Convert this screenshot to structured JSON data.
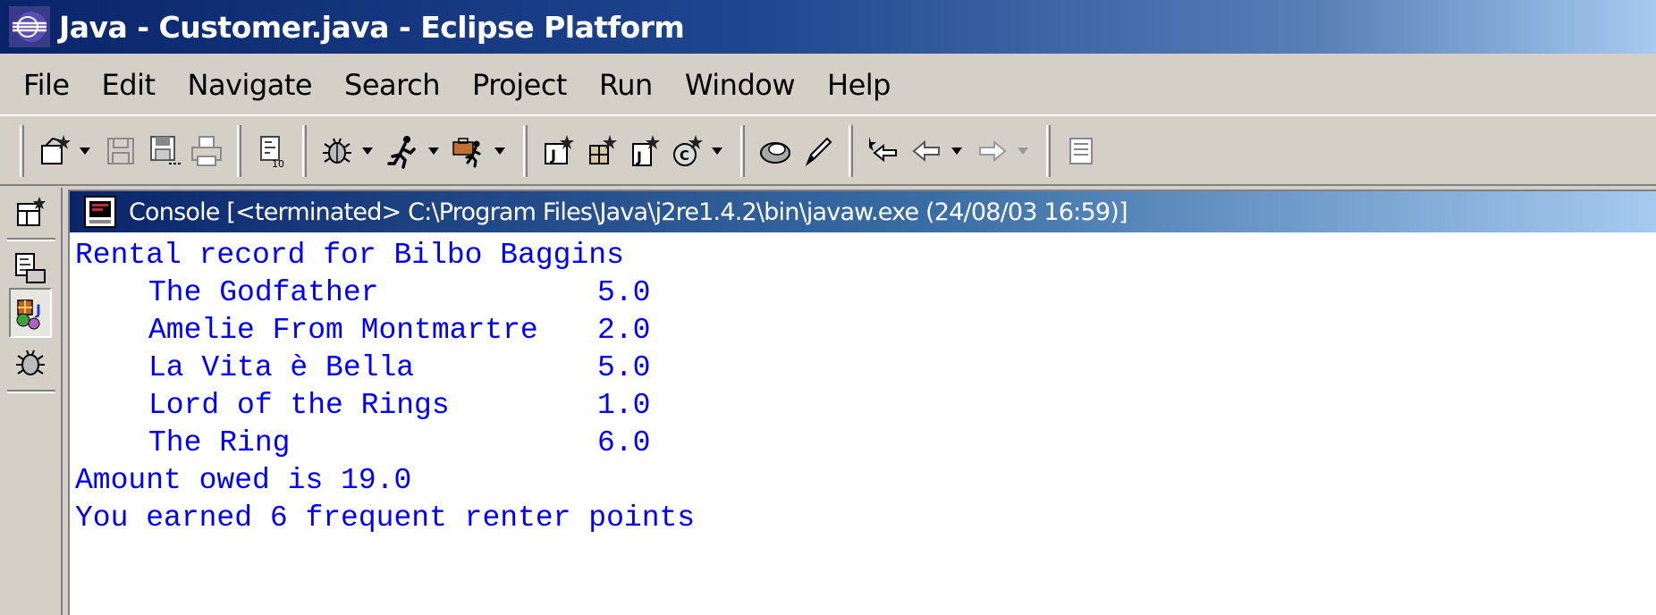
{
  "window": {
    "title": "Java - Customer.java - Eclipse Platform"
  },
  "menu": [
    "File",
    "Edit",
    "Navigate",
    "Search",
    "Project",
    "Run",
    "Window",
    "Help"
  ],
  "toolbar": {
    "icons": [
      "new-wizard-icon",
      "save-icon",
      "save-all-icon",
      "print-icon",
      "open-type-icon",
      "debug-icon",
      "run-icon",
      "external-tools-icon",
      "new-project-icon",
      "new-package-icon",
      "new-interface-icon",
      "new-class-icon",
      "search-icon",
      "edit-pencil-icon",
      "last-edit-icon",
      "back-icon",
      "forward-icon",
      "perspective-icon"
    ]
  },
  "left_toolbar": {
    "icons": [
      "open-perspective-icon",
      "resource-perspective-icon",
      "java-perspective-icon",
      "debug-perspective-icon"
    ],
    "active": "java-perspective-icon"
  },
  "console": {
    "title": "Console [<terminated> C:\\Program Files\\Java\\j2re1.4.2\\bin\\javaw.exe (24/08/03 16:59)]",
    "header_line": "Rental record for Bilbo Baggins",
    "rentals": [
      {
        "title": "The Godfather",
        "amount": "5.0"
      },
      {
        "title": "Amelie From Montmartre",
        "amount": "2.0"
      },
      {
        "title": "La Vita è Bella",
        "amount": "5.0"
      },
      {
        "title": "Lord of the Rings",
        "amount": "1.0"
      },
      {
        "title": "The Ring",
        "amount": "6.0"
      }
    ],
    "amount_line": "Amount owed is 19.0",
    "points_line": "You earned 6 frequent renter points"
  },
  "colors": {
    "title_bar": "#0a246a",
    "console_text": "#0000ff",
    "chrome": "#d4d0c8"
  }
}
